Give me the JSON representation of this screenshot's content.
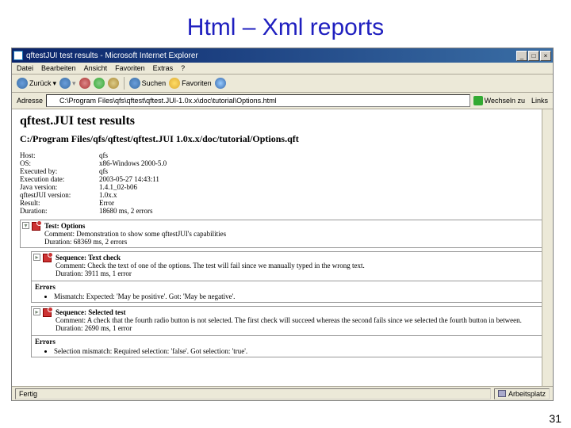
{
  "slide": {
    "title": "Html – Xml reports",
    "page_number": "31"
  },
  "window": {
    "title": "qftestJUI test results - Microsoft Internet Explorer",
    "controls": {
      "min": "_",
      "max": "□",
      "close": "×"
    }
  },
  "menu": {
    "items": [
      "Datei",
      "Bearbeiten",
      "Ansicht",
      "Favoriten",
      "Extras",
      "?"
    ]
  },
  "toolbar": {
    "back": "Zurück",
    "forward": "",
    "search": "Suchen",
    "favorites": "Favoriten"
  },
  "address": {
    "label": "Adresse",
    "value": "C:\\Program Files\\qfs\\qftest\\qftest.JUI-1.0x.x\\doc\\tutorial\\Options.html",
    "go": "Wechseln zu",
    "links": "Links"
  },
  "report": {
    "h1": "qftest.JUI test results",
    "h2": "C:/Program Files/qfs/qftest/qftest.JUI 1.0x.x/doc/tutorial/Options.qft",
    "kv": [
      {
        "k": "Host:",
        "v": "qfs"
      },
      {
        "k": "OS:",
        "v": "x86-Windows 2000-5.0"
      },
      {
        "k": "Executed by:",
        "v": "qfs"
      },
      {
        "k": "Execution date:",
        "v": "2003-05-27 14:43:11"
      },
      {
        "k": "Java version:",
        "v": "1.4.1_02-b06"
      },
      {
        "k": "qftestJUI version:",
        "v": "1.0x.x"
      },
      {
        "k": "Result:",
        "v": "Error"
      },
      {
        "k": "Duration:",
        "v": "18680 ms, 2 errors"
      }
    ],
    "nodes": [
      {
        "title": "Test: Options",
        "comment": "Comment: Demonstration to show some qftestJUI's capabilities",
        "duration": "Duration: 68369 ms, 2 errors",
        "errors": []
      },
      {
        "title": "Sequence: Text check",
        "comment": "Comment: Check the text of one of the options. The test will fail since we manually typed in the wrong text.",
        "duration": "Duration: 3911 ms, 1 error",
        "errors_title": "Errors",
        "errors": [
          "Mismatch: Expected: 'May be positive'. Got: 'May be negative'."
        ]
      },
      {
        "title": "Sequence: Selected test",
        "comment": "Comment: A check that the fourth radio button is not selected. The first check will succeed whereas the second fails since we selected the fourth button in between.",
        "duration": "Duration: 2690 ms, 1 error",
        "errors_title": "Errors",
        "errors": [
          "Selection mismatch: Required selection: 'false'. Got selection: 'true'."
        ]
      }
    ]
  },
  "status": {
    "done": "Fertig",
    "zone": "Arbeitsplatz"
  }
}
